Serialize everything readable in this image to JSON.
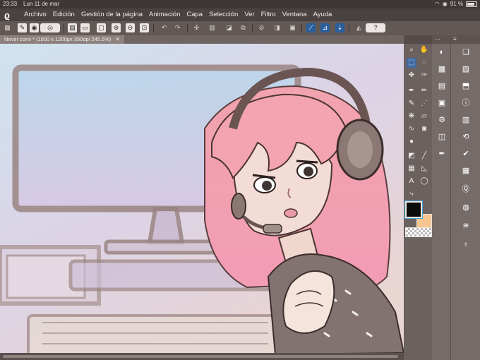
{
  "status": {
    "time": "23:33",
    "date": "Lun 11 de mar",
    "battery": "91 %"
  },
  "app": {
    "logo": "ϱ"
  },
  "menu": [
    "Archivo",
    "Edición",
    "Gestión de la página",
    "Animación",
    "Capa",
    "Selección",
    "Ver",
    "Filtro",
    "Ventana",
    "Ayuda"
  ],
  "toolbar": {
    "icons": [
      "grid-icon",
      "new-icon",
      "brush-size-icon",
      "new-file-icon",
      "open-file-icon",
      "save-icon",
      "zoom-in-icon",
      "zoom-out-icon",
      "zoom-fit-icon",
      "undo-icon",
      "redo-icon",
      "transform-icon",
      "transform-alt-icon",
      "fill-icon",
      "select-icon",
      "clear-icon",
      "flip-icon",
      "invert-icon",
      "ruler-icon",
      "snap-icon",
      "snap-alt-icon",
      "hat-icon",
      "help-icon"
    ],
    "help_label": "?"
  },
  "document": {
    "tab_title": "Never comi * (1900 x 1200px 350dpi 245.5%)",
    "close": "✕"
  },
  "tools": [
    "zoom-icon",
    "hand-icon",
    "move-icon",
    "lasso-icon",
    "select-pen-icon",
    "eyedropper-icon",
    "pen-icon",
    "pencil-icon",
    "brush-icon",
    "airbrush-icon",
    "decoration-icon",
    "eraser-icon",
    "blend-icon",
    "fill-icon",
    "gradient-icon",
    "figure-icon",
    "ruler-icon",
    "text-icon",
    "balloon-icon",
    "line-correction-icon"
  ],
  "colors": {
    "main": "#0b0b0b",
    "sub": "#f6c48e",
    "accent": "#3f6ba3"
  },
  "right_panel": {
    "icons": [
      "color-wheel-icon",
      "layers-icon",
      "navigator-icon",
      "properties-icon",
      "info-icon",
      "gear-icon",
      "camera-icon",
      "history-icon",
      "calligraphy-icon",
      "anim-icon",
      "quick-icon",
      "swirl-icon",
      "light-icon"
    ]
  },
  "panel_icons_left": [
    "color-icon",
    "palette-icon",
    "image-icon",
    "download-icon",
    "circle-icon",
    "sequence-icon",
    "history-icon",
    "quick-access-icon",
    "brush-icon"
  ]
}
